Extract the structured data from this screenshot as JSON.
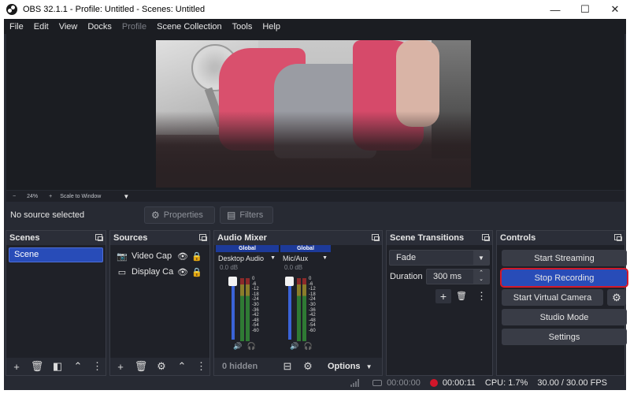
{
  "window": {
    "title": "OBS 32.1.1 - Profile: Untitled - Scenes: Untitled",
    "minimize": "—",
    "maximize": "☐",
    "close": "✕"
  },
  "menu": [
    "File",
    "Edit",
    "View",
    "Docks",
    "Profile",
    "Scene Collection",
    "Tools",
    "Help"
  ],
  "preview": {
    "zoom_minus": "−",
    "zoom_level": "24%",
    "zoom_plus": "+",
    "scale_mode": "Scale to Window"
  },
  "source_toolbar": {
    "no_source": "No source selected",
    "properties": "Properties",
    "filters": "Filters"
  },
  "scenes": {
    "title": "Scenes",
    "items": [
      "Scene"
    ]
  },
  "sources": {
    "title": "Sources",
    "items": [
      {
        "name": "Video Cap",
        "icon": "camera-icon"
      },
      {
        "name": "Display Ca",
        "icon": "monitor-icon"
      }
    ]
  },
  "audio_mixer": {
    "title": "Audio Mixer",
    "strips": [
      {
        "global": "Global",
        "device": "Desktop Audio",
        "db": "0.0 dB",
        "level": 0.0
      },
      {
        "global": "Global",
        "device": "Mic/Aux",
        "db": "0.0 dB",
        "level": 0.0
      }
    ],
    "scale": [
      "0",
      "-6",
      "-12",
      "-18",
      "-24",
      "-30",
      "-36",
      "-42",
      "-48",
      "-54",
      "-60"
    ],
    "hidden": "0 hidden",
    "options": "Options"
  },
  "transitions": {
    "title": "Scene Transitions",
    "type": "Fade",
    "duration_label": "Duration",
    "duration": "300 ms"
  },
  "controls": {
    "title": "Controls",
    "start_streaming": "Start Streaming",
    "stop_recording": "Stop Recording",
    "start_virtual_camera": "Start Virtual Camera",
    "studio_mode": "Studio Mode",
    "settings": "Settings"
  },
  "status": {
    "stream_time": "00:00:00",
    "record_time": "00:00:11",
    "cpu": "CPU: 1.7%",
    "fps": "30.00 / 30.00 FPS"
  },
  "colors": {
    "accent": "#284cb8",
    "record": "#d1162a",
    "highlight_border": "#d3192a"
  }
}
